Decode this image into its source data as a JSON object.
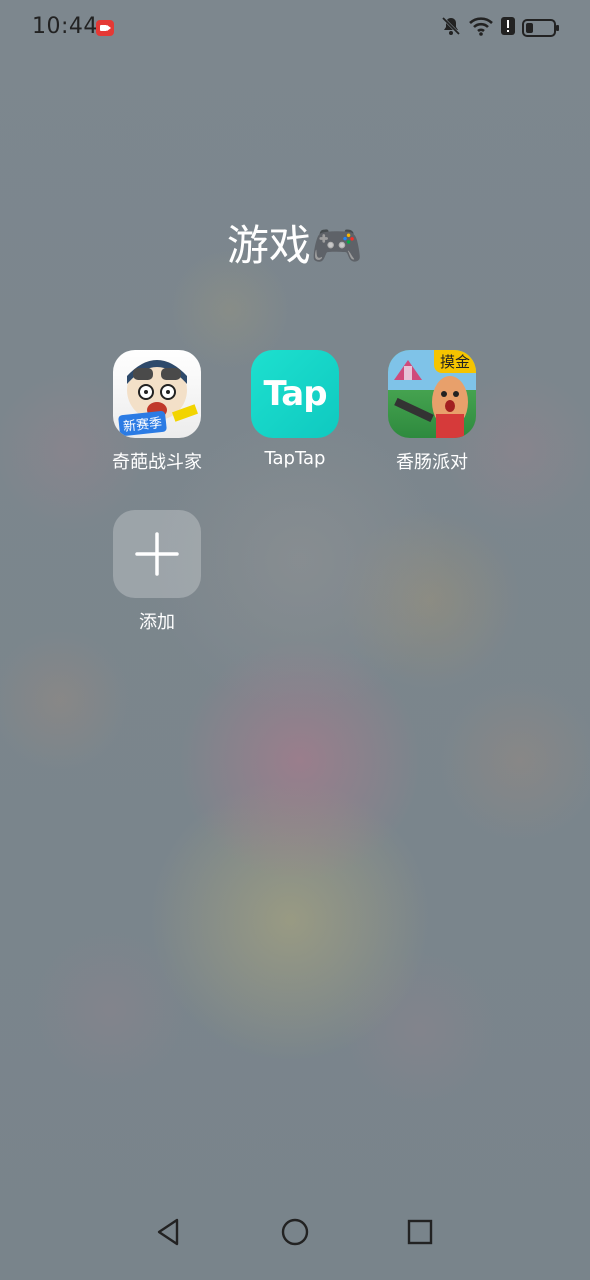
{
  "status_bar": {
    "time": "10:44",
    "icons": [
      "screen-record-icon",
      "mute-icon",
      "wifi-icon",
      "alert-icon",
      "battery-icon"
    ],
    "battery_level_percent": 25
  },
  "folder": {
    "title": "游戏🎮",
    "apps": [
      {
        "label": "奇葩战斗家",
        "icon": "qipa-zhandoujia-icon",
        "badge": "新赛季"
      },
      {
        "label": "TapTap",
        "icon": "taptap-icon",
        "icon_text": "Tap"
      },
      {
        "label": "香肠派对",
        "icon": "xiangchang-paidui-icon",
        "badge": "摸金"
      },
      {
        "label": "添加",
        "icon": "plus-icon"
      }
    ]
  },
  "nav_bar": {
    "icons": [
      "back-icon",
      "home-icon",
      "recents-icon"
    ]
  },
  "colors": {
    "background": "#7b868d",
    "taptap": "#19d9ca",
    "status_text": "#222222"
  }
}
